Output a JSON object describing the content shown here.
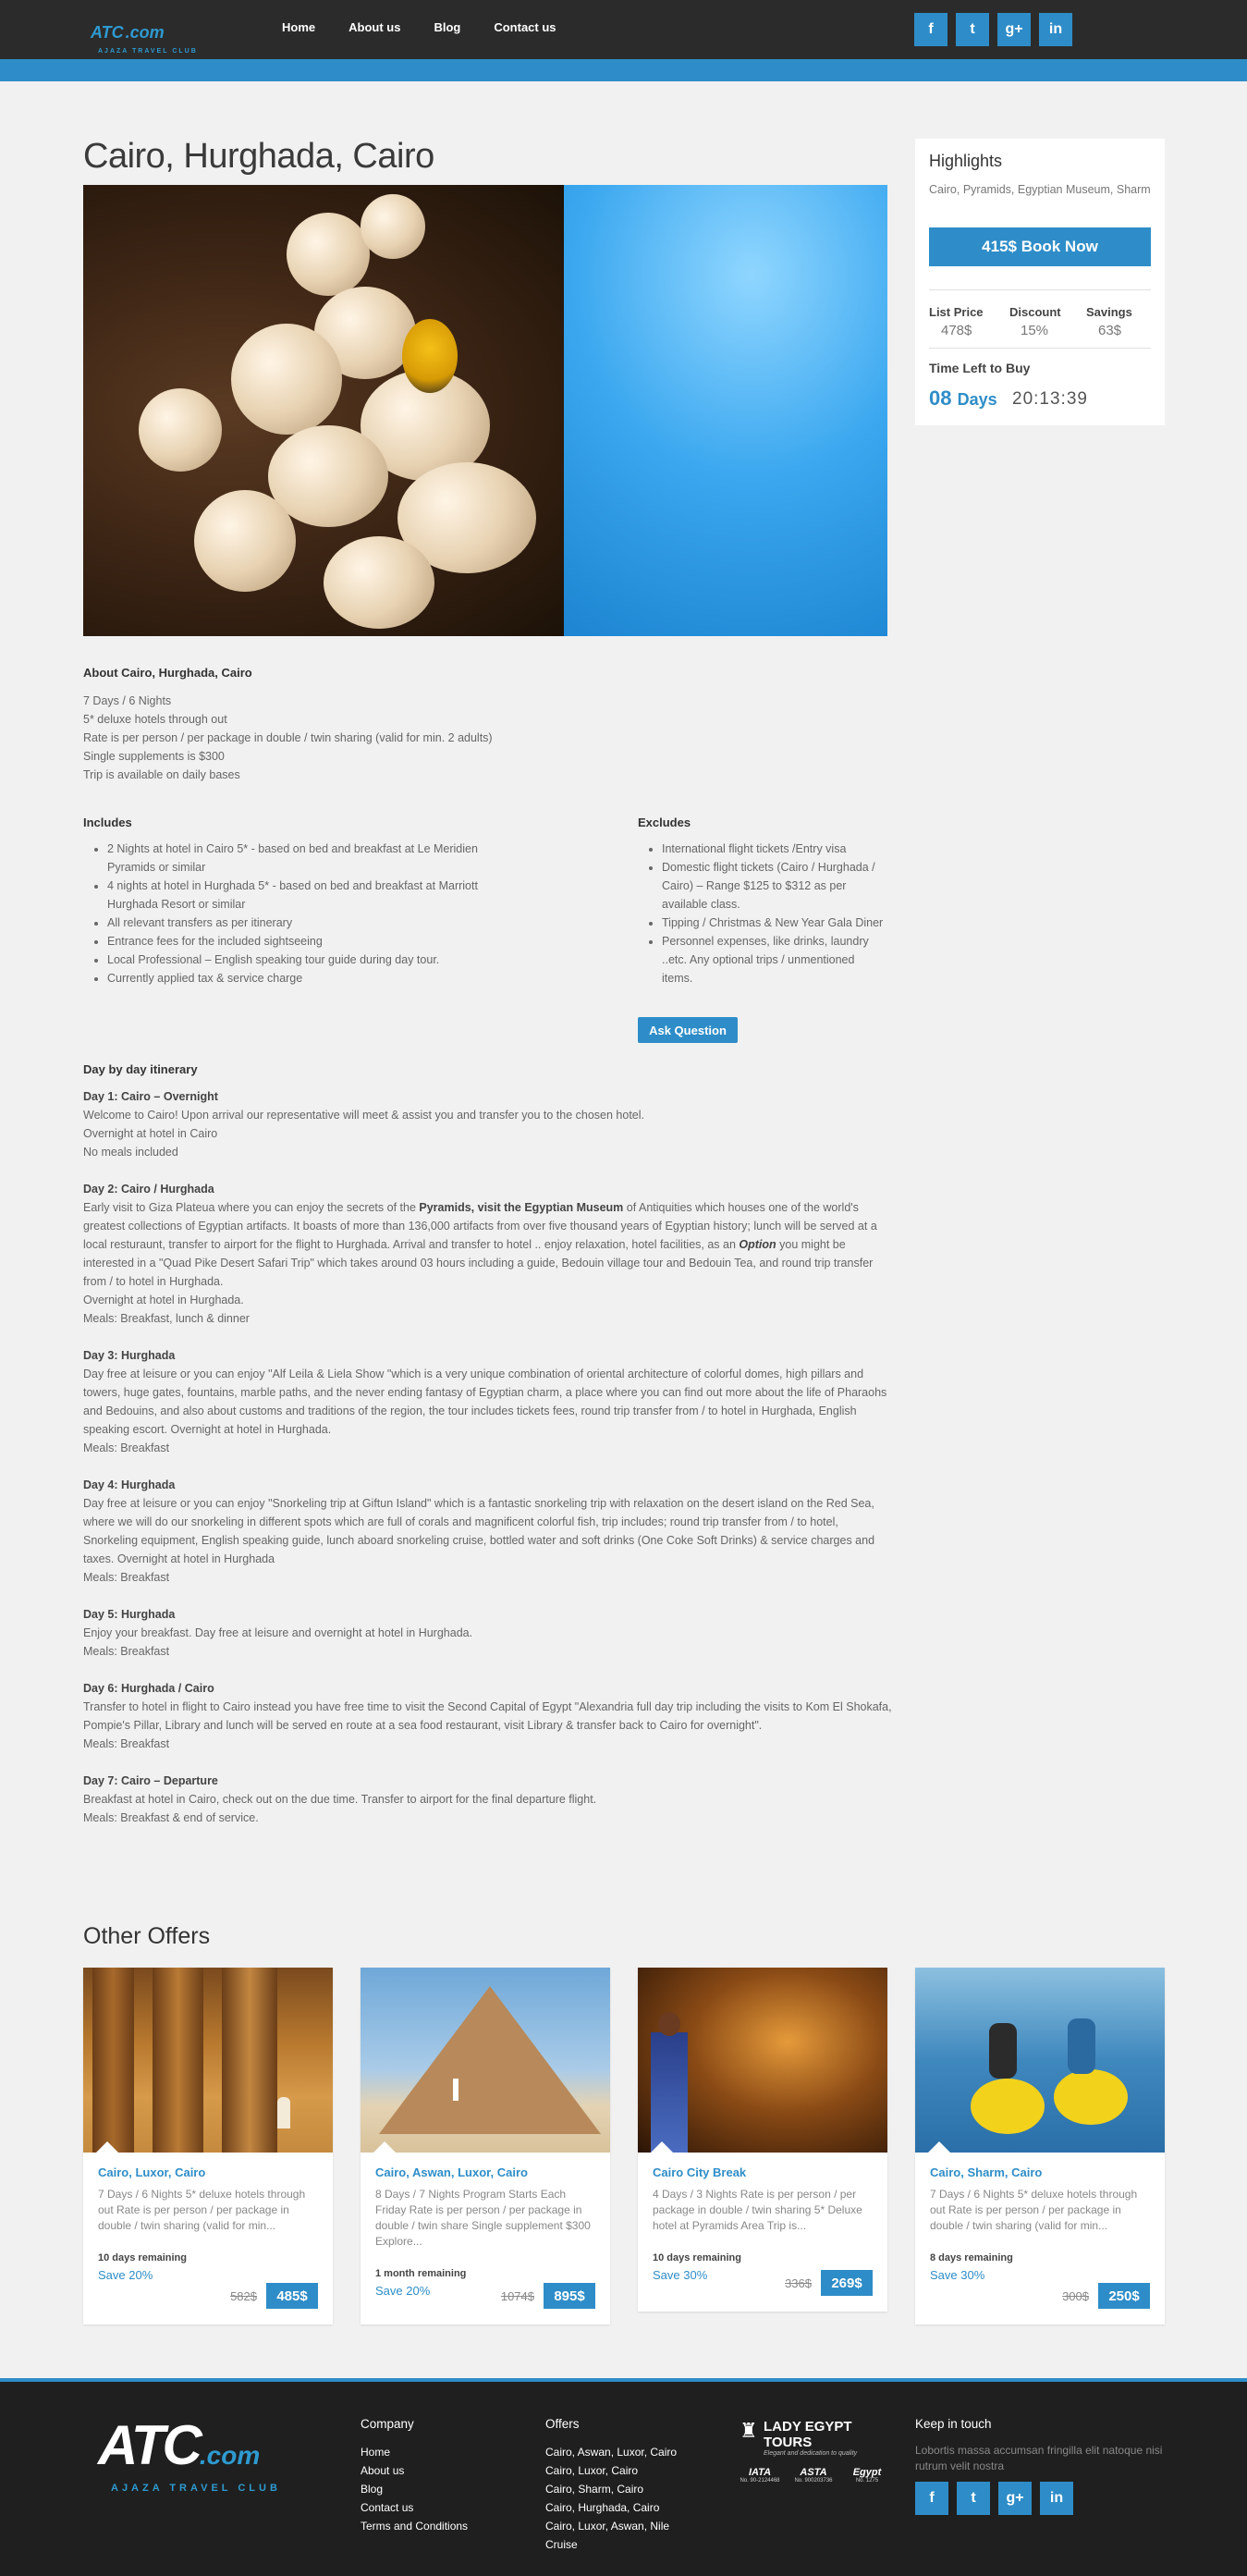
{
  "brand": {
    "logo_main": "ATC",
    "logo_suffix": ".com",
    "logo_tag": "AJAZA TRAVEL CLUB"
  },
  "nav": {
    "items": [
      "Home",
      "About us",
      "Blog",
      "Contact us"
    ]
  },
  "social": {
    "facebook": "f",
    "twitter": "t",
    "googleplus": "g+",
    "linkedin": "in"
  },
  "page": {
    "title": "Cairo, Hurghada, Cairo"
  },
  "highlights": {
    "title": "Highlights",
    "subtitle": "Cairo, Pyramids, Egyptian Museum, Sharm",
    "book_label": "415$ Book Now",
    "list_price_label": "List Price",
    "list_price": "478$",
    "discount_label": "Discount",
    "discount": "15%",
    "savings_label": "Savings",
    "savings": "63$",
    "time_left_label": "Time Left to Buy",
    "days_num": "08",
    "days_word": "Days",
    "clock": "20:13:39"
  },
  "about": {
    "heading": "About Cairo, Hurghada, Cairo",
    "lines": [
      "7 Days / 6 Nights",
      "5* deluxe hotels through out",
      "Rate is per person / per package in double / twin sharing (valid for min. 2 adults)",
      "Single supplements is $300",
      "Trip is available on daily bases"
    ]
  },
  "includes": {
    "heading": "Includes",
    "items": [
      "2 Nights at hotel in Cairo 5* - based on bed and breakfast at Le Meridien Pyramids or similar",
      "4 nights at hotel in Hurghada 5* - based on bed and breakfast at Marriott Hurghada Resort or similar",
      "All relevant transfers as per itinerary",
      "Entrance fees for the included sightseeing",
      "Local Professional – English speaking tour guide during day tour.",
      "Currently applied tax & service charge"
    ]
  },
  "excludes": {
    "heading": "Excludes",
    "items": [
      "International flight tickets /Entry visa",
      "Domestic flight tickets (Cairo / Hurghada / Cairo) – Range $125 to $312 as per available class.",
      "Tipping / Christmas & New Year Gala Diner",
      "Personnel expenses, like drinks, laundry ..etc. Any optional trips / unmentioned items."
    ],
    "ask_label": "Ask Question"
  },
  "itinerary": {
    "heading": "Day by day itinerary",
    "d1_title": "Day 1: Cairo – Overnight",
    "d1_l1": "Welcome to Cairo! Upon arrival our representative will meet & assist you and transfer you to the chosen hotel.",
    "d1_l2": "Overnight at hotel in Cairo",
    "d1_l3": "No meals included",
    "d2_title": "Day 2: Cairo / Hurghada",
    "d2_a": "Early visit to Giza Plateua where you can enjoy the secrets of the ",
    "d2_b": "Pyramids, visit the Egyptian Museum",
    "d2_c": " of Antiquities which houses one of the world's greatest collections of Egyptian artifacts. It boasts of more than 136,000 artifacts from over five thousand years of Egyptian history; lunch will be served at a local resturaunt, transfer to airport for the flight to Hurghada. Arrival and transfer to hotel .. enjoy relaxation, hotel facilities, as an ",
    "d2_d": "Option",
    "d2_e": " you might be interested in a \"Quad Pike Desert Safari Trip\" which takes around 03 hours including a guide, Bedouin village tour and Bedouin Tea, and round trip transfer from / to hotel in Hurghada.",
    "d2_l2": "Overnight at hotel in Hurghada.",
    "d2_l3": "Meals:  Breakfast, lunch & dinner",
    "d3_title": "Day 3: Hurghada",
    "d3_l1": "Day free at leisure or you can enjoy \"Alf Leila & Liela Show \"which is a very unique combination of oriental architecture of colorful domes, high pillars and towers, huge gates, fountains, marble paths, and the never ending fantasy of Egyptian charm, a place where you can find out more about the life of Pharaohs and Bedouins, and also about customs and traditions of the region, the tour includes tickets fees, round trip transfer from / to hotel in Hurghada, English speaking escort. Overnight at hotel in Hurghada.",
    "d3_l2": "Meals: Breakfast",
    "d4_title": "Day 4: Hurghada",
    "d4_l1": "Day free at leisure or you can enjoy \"Snorkeling trip at Giftun Island\" which is a fantastic snorkeling trip with relaxation on the desert island on the Red Sea, where we will do our snorkeling in different spots which are full of corals and magnificent colorful fish, trip includes; round trip transfer from / to hotel, Snorkeling equipment, English speaking guide, lunch aboard snorkeling cruise, bottled water and soft drinks (One Coke Soft Drinks) & service charges and taxes. Overnight at hotel in Hurghada",
    "d4_l2": "Meals: Breakfast",
    "d5_title": "Day 5: Hurghada",
    "d5_l1": "Enjoy your breakfast. Day free at leisure and overnight at hotel in Hurghada.",
    "d5_l2": "Meals: Breakfast",
    "d6_title": "Day 6: Hurghada / Cairo",
    "d6_l1": "Transfer to hotel in flight to Cairo  instead you have free time to visit the Second Capital of Egypt \"Alexandria full day trip including the visits to Kom El Shokafa, Pompie's Pillar, Library and lunch will be served en route at a sea food restaurant, visit Library & transfer back to Cairo for overnight\".",
    "d6_l2": "Meals: Breakfast",
    "d7_title": "Day 7: Cairo – Departure",
    "d7_l1": "Breakfast at hotel in Cairo, check out on the due time. Transfer to airport for the final departure flight.",
    "d7_l2": "Meals: Breakfast & end of service."
  },
  "offers": {
    "heading": "Other Offers",
    "cards": [
      {
        "name": "Cairo, Luxor, Cairo",
        "desc": "7 Days / 6 Nights 5* deluxe hotels through out Rate is per person / per package in double / twin sharing (valid for min...",
        "remaining": "10 days remaining",
        "save": "Save 20%",
        "old": "582$",
        "new": "485$"
      },
      {
        "name": "Cairo, Aswan, Luxor, Cairo",
        "desc": "8 Days / 7 Nights Program Starts Each Friday Rate is per person / per package in double / twin share Single supplement $300 Explore...",
        "remaining": "1 month remaining",
        "save": "Save 20%",
        "old": "1074$",
        "new": "895$"
      },
      {
        "name": "Cairo City Break",
        "desc": "4 Days / 3 Nights Rate is per person / per package in double / twin sharing 5* Deluxe hotel at Pyramids Area Trip is...",
        "remaining": "10 days remaining",
        "save": "Save 30%",
        "old": "336$",
        "new": "269$"
      },
      {
        "name": "Cairo, Sharm, Cairo",
        "desc": "7 Days / 6 Nights 5* deluxe hotels through out Rate is per person / per package in double / twin sharing (valid for min...",
        "remaining": "8 days remaining",
        "save": "Save 30%",
        "old": "300$",
        "new": "250$"
      }
    ]
  },
  "footer": {
    "company_heading": "Company",
    "company_links": [
      "Home",
      "About us",
      "Blog",
      "Contact us",
      "Terms and Conditions"
    ],
    "offers_heading": "Offers",
    "offer_links": [
      "Cairo, Aswan, Luxor, Cairo",
      "Cairo, Luxor, Cairo",
      "Cairo, Sharm, Cairo",
      "Cairo, Hurghada, Cairo",
      "Cairo, Luxor, Aswan, Nile",
      "Cruise"
    ],
    "partner_name": "LADY EGYPT TOURS",
    "partner_tag": "Elegant and dedication to quality",
    "badge1": "IATA",
    "badge1_no": "No. 90-2124468",
    "badge2": "ASTA",
    "badge2_no": "No. 900203736",
    "badge3": "Egypt",
    "badge3_no": "No. 1275",
    "keep_heading": "Keep in touch",
    "keep_text": "Lobortis massa accumsan fringilla elit natoque nisi rutrum velit nostra"
  },
  "colors": {
    "accent": "#2e8dc8",
    "dark": "#2b2b2b"
  }
}
